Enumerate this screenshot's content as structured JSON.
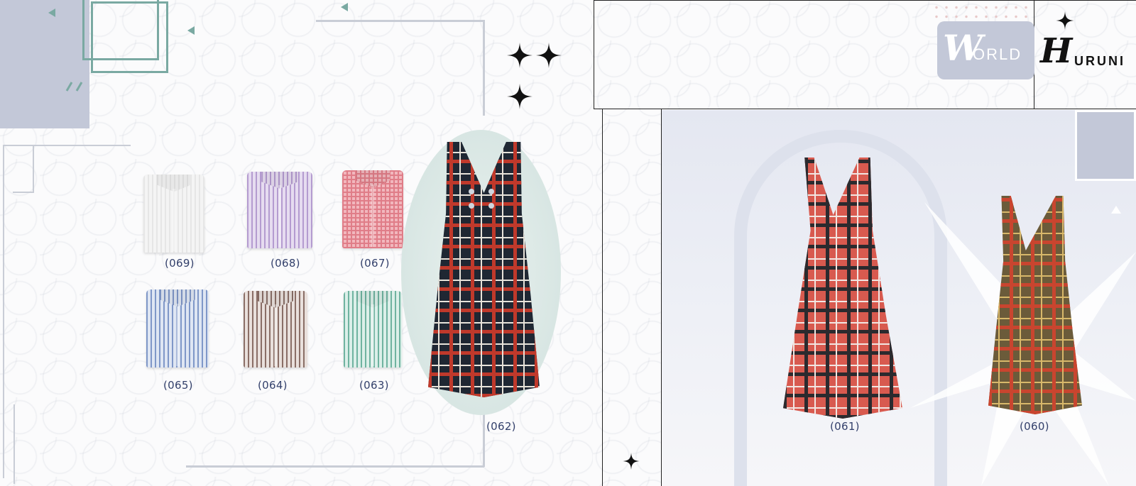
{
  "brand": {
    "word1": "ORLD",
    "word1_initial": "W",
    "word2": "URUNI",
    "word2_initial": "H"
  },
  "left_page": {
    "shirts": [
      {
        "code": "(069)",
        "color_name": "white",
        "color": "#f4f4f4",
        "stripe": "#e6e6e6"
      },
      {
        "code": "(068)",
        "color_name": "lilac stripe",
        "color": "#e6dcf0",
        "stripe": "#b49bd0"
      },
      {
        "code": "(067)",
        "color_name": "pink gingham",
        "color": "#f1b7bd",
        "stripe": "#e07d88"
      },
      {
        "code": "(065)",
        "color_name": "blue stripe",
        "color": "#dfe6f3",
        "stripe": "#7f97c8"
      },
      {
        "code": "(064)",
        "color_name": "brown stripe",
        "color": "#e9e0dc",
        "stripe": "#8a6e66"
      },
      {
        "code": "(063)",
        "color_name": "green stripe",
        "color": "#dcefe9",
        "stripe": "#6fb3a0"
      }
    ],
    "pinafore": {
      "code": "(062)",
      "base": "#1f2733",
      "line1": "#c0392b",
      "line2": "#e8e3da"
    }
  },
  "right_page": {
    "pinafores": [
      {
        "code": "(061)",
        "base": "#d85a4f",
        "line1": "#2b2a2e",
        "line2": "#f2e6e2"
      },
      {
        "code": "(060)",
        "base": "#6b5b3a",
        "line1": "#c9452f",
        "line2": "#d8b86a"
      }
    ]
  },
  "colors": {
    "accent_slate": "#c3c8d8",
    "accent_teal": "#7aa9a2",
    "line_gray": "#c9cdd6",
    "code_text": "#33406b"
  }
}
